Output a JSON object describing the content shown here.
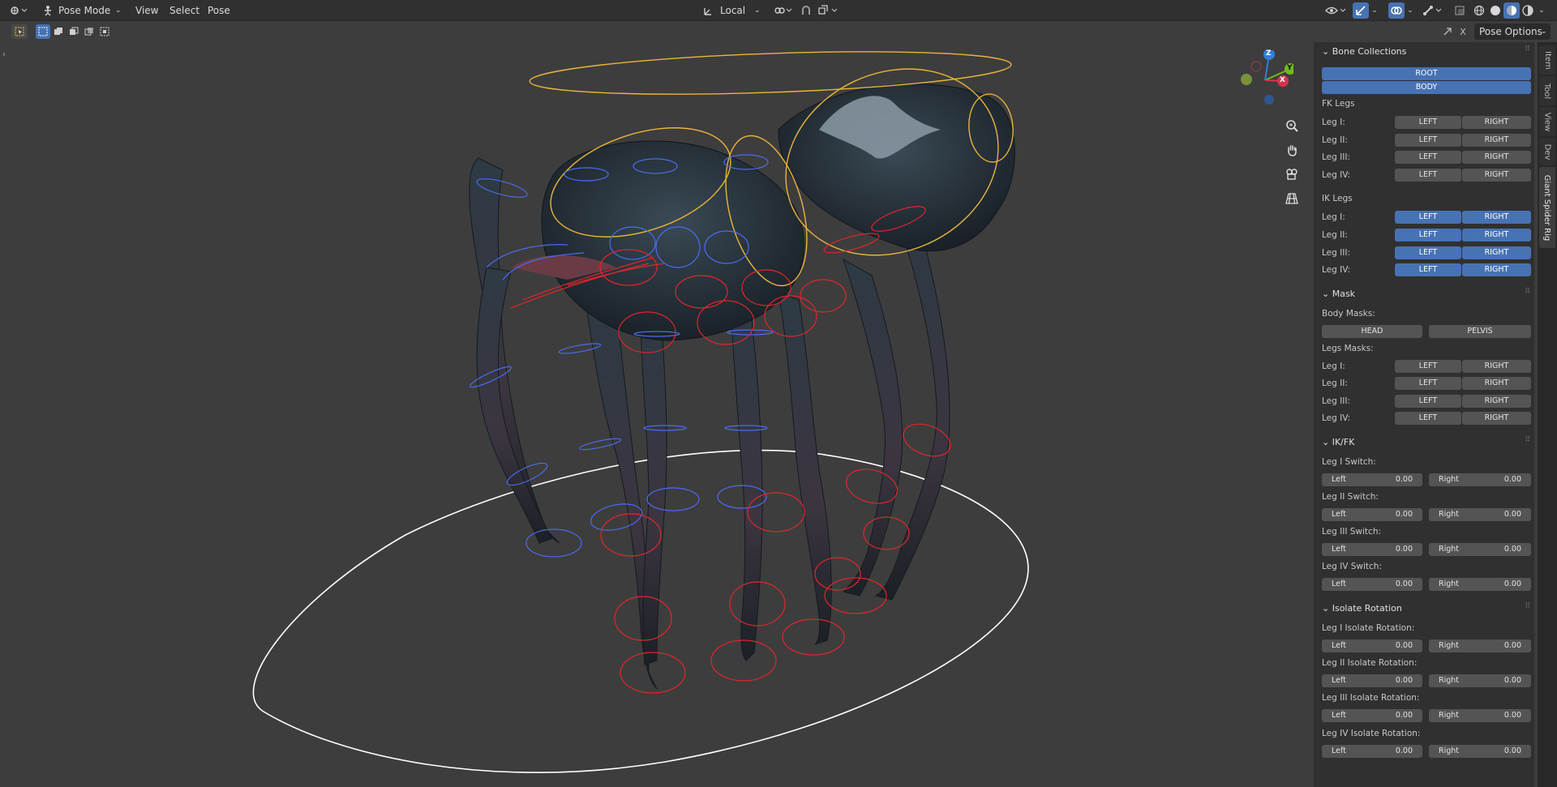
{
  "header": {
    "mode": "Pose Mode",
    "menus": [
      "View",
      "Select",
      "Pose"
    ],
    "transform_orientation": "Local"
  },
  "subheader": {
    "pose_options": "Pose Options",
    "close_glyph": "X"
  },
  "gizmo": {
    "z": "Z",
    "y": "Y",
    "x": "X"
  },
  "side_tabs": [
    "Item",
    "Tool",
    "View",
    "Dev",
    "Giant Spider Rig"
  ],
  "panel": {
    "bone_collections": {
      "title": "Bone Collections",
      "buttons": [
        "ROOT",
        "BODY"
      ],
      "fk_title": "FK Legs",
      "fk_rows": [
        {
          "label": "Leg I:",
          "left": "LEFT",
          "right": "RIGHT"
        },
        {
          "label": "Leg II:",
          "left": "LEFT",
          "right": "RIGHT"
        },
        {
          "label": "Leg III:",
          "left": "LEFT",
          "right": "RIGHT"
        },
        {
          "label": "Leg IV:",
          "left": "LEFT",
          "right": "RIGHT"
        }
      ],
      "ik_title": "IK Legs",
      "ik_rows": [
        {
          "label": "Leg I:",
          "left": "LEFT",
          "right": "RIGHT"
        },
        {
          "label": "Leg II:",
          "left": "LEFT",
          "right": "RIGHT"
        },
        {
          "label": "Leg III:",
          "left": "LEFT",
          "right": "RIGHT"
        },
        {
          "label": "Leg IV:",
          "left": "LEFT",
          "right": "RIGHT"
        }
      ]
    },
    "mask": {
      "title": "Mask",
      "body_label": "Body Masks:",
      "body_buttons": [
        "HEAD",
        "PELVIS"
      ],
      "legs_label": "Legs Masks:",
      "leg_rows": [
        {
          "label": "Leg I:",
          "left": "LEFT",
          "right": "RIGHT"
        },
        {
          "label": "Leg II:",
          "left": "LEFT",
          "right": "RIGHT"
        },
        {
          "label": "Leg III:",
          "left": "LEFT",
          "right": "RIGHT"
        },
        {
          "label": "Leg IV:",
          "left": "LEFT",
          "right": "RIGHT"
        }
      ]
    },
    "ikfk": {
      "title": "IK/FK",
      "rows": [
        {
          "label": "Leg I Switch:",
          "left_label": "Left",
          "left_value": "0.00",
          "right_label": "Right",
          "right_value": "0.00"
        },
        {
          "label": "Leg II Switch:",
          "left_label": "Left",
          "left_value": "0.00",
          "right_label": "Right",
          "right_value": "0.00"
        },
        {
          "label": "Leg III Switch:",
          "left_label": "Left",
          "left_value": "0.00",
          "right_label": "Right",
          "right_value": "0.00"
        },
        {
          "label": "Leg IV Switch:",
          "left_label": "Left",
          "left_value": "0.00",
          "right_label": "Right",
          "right_value": "0.00"
        }
      ]
    },
    "isolate": {
      "title": "Isolate Rotation",
      "rows": [
        {
          "label": "Leg I Isolate Rotation:",
          "left_label": "Left",
          "left_value": "0.00",
          "right_label": "Right",
          "right_value": "0.00"
        },
        {
          "label": "Leg II Isolate Rotation:",
          "left_label": "Left",
          "left_value": "0.00",
          "right_label": "Right",
          "right_value": "0.00"
        },
        {
          "label": "Leg III Isolate Rotation:",
          "left_label": "Left",
          "left_value": "0.00",
          "right_label": "Right",
          "right_value": "0.00"
        },
        {
          "label": "Leg IV Isolate Rotation:",
          "left_label": "Left",
          "left_value": "0.00",
          "right_label": "Right",
          "right_value": "0.00"
        }
      ]
    }
  },
  "colors": {
    "accent": "#4772b3",
    "viewport_bg": "#3d3d3d",
    "bone_blue": "#4a6cf0",
    "bone_red": "#e0262b",
    "bone_yellow": "#e8b53c"
  }
}
